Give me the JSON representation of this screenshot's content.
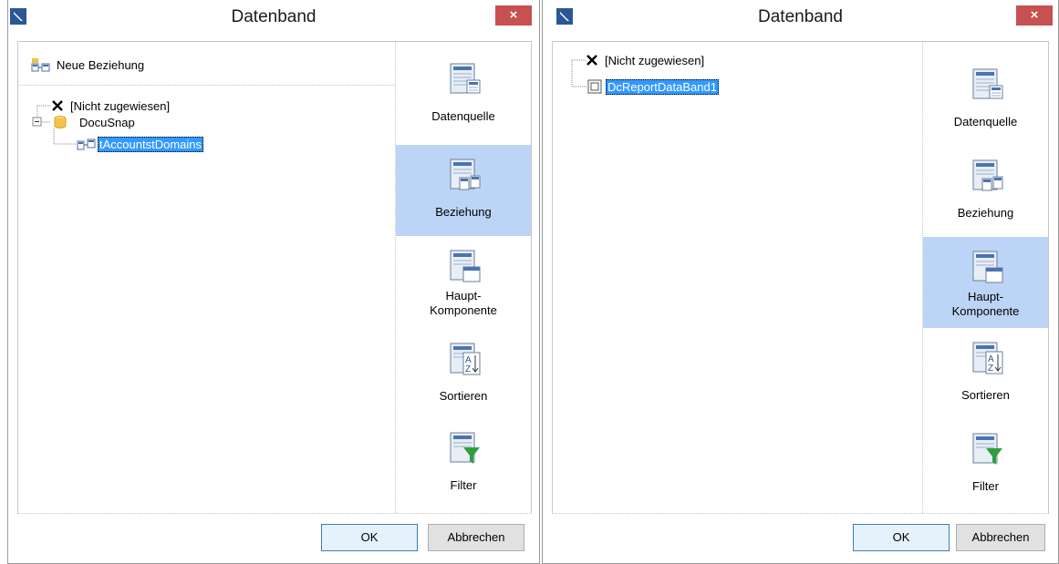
{
  "dialog_left": {
    "title": "Datenband",
    "close_label": "×",
    "new_relation_label": "Neue Beziehung",
    "tree": {
      "not_assigned": "[Nicht zugewiesen]",
      "datasource": "DocuSnap",
      "table": "tAccountstDomains"
    },
    "side": {
      "datasource": "Datenquelle",
      "relation": "Beziehung",
      "master_line1": "Haupt-",
      "master_line2": "Komponente",
      "sort": "Sortieren",
      "filter": "Filter"
    },
    "active_side": "Beziehung",
    "ok_label": "OK",
    "cancel_label": "Abbrechen"
  },
  "dialog_right": {
    "title": "Datenband",
    "close_label": "×",
    "tree": {
      "not_assigned": "[Nicht zugewiesen]",
      "band": "DcReportDataBand1"
    },
    "side": {
      "datasource": "Datenquelle",
      "relation": "Beziehung",
      "master_line1": "Haupt-",
      "master_line2": "Komponente",
      "sort": "Sortieren",
      "filter": "Filter"
    },
    "active_side": "Haupt-Komponente",
    "ok_label": "OK",
    "cancel_label": "Abbrechen"
  },
  "colors": {
    "close": "#c75050",
    "selection": "#3399ff",
    "active_side": "#bcd4f6",
    "ok_border": "#3c7fb1",
    "filter_funnel": "#2e9e3e",
    "db_cylinder": "#f2c24a"
  },
  "icons": [
    "app-icon",
    "close-icon",
    "relation-icon",
    "delete-x-icon",
    "database-icon",
    "table-relation-icon",
    "band-icon",
    "datasource-icon",
    "master-component-icon",
    "sort-az-icon",
    "filter-icon"
  ]
}
